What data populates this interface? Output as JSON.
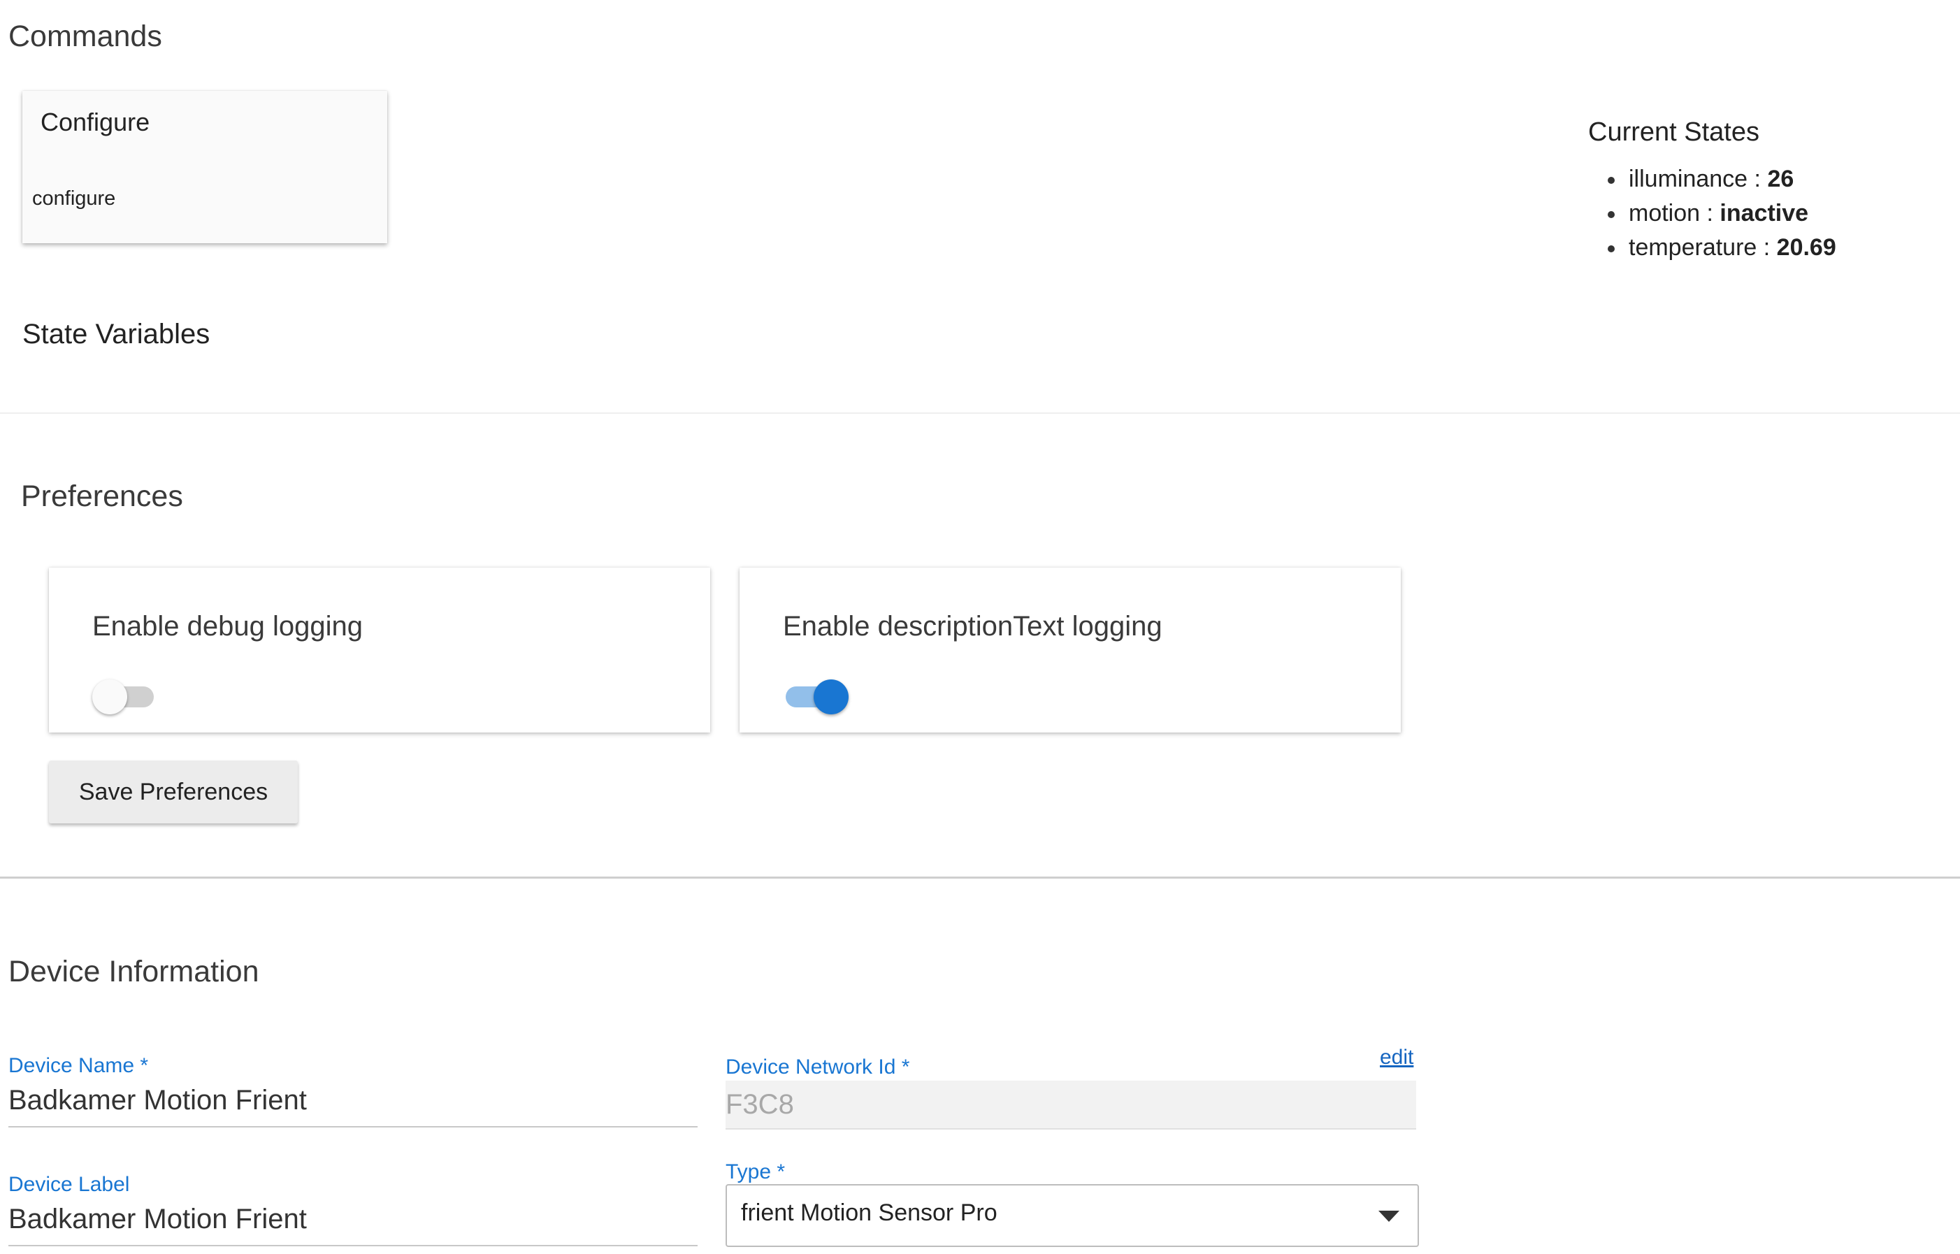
{
  "commands": {
    "title": "Commands",
    "card_title": "Configure",
    "card_button": "configure"
  },
  "current_states": {
    "title": "Current States",
    "items": [
      {
        "name": "illuminance",
        "sep": " : ",
        "value": "26"
      },
      {
        "name": "motion",
        "sep": " : ",
        "value": "inactive"
      },
      {
        "name": "temperature",
        "sep": " : ",
        "value": "20.69"
      }
    ]
  },
  "state_variables": {
    "title": "State Variables"
  },
  "preferences": {
    "title": "Preferences",
    "items": [
      {
        "label": "Enable debug logging",
        "enabled": false
      },
      {
        "label": "Enable descriptionText logging",
        "enabled": true
      }
    ],
    "save_label": "Save Preferences",
    "colors": {
      "toggle_on": "#1976d2",
      "toggle_on_track": "#92bfea",
      "toggle_off_track": "#d0d0d0"
    }
  },
  "device_info": {
    "title": "Device Information",
    "device_name": {
      "label": "Device Name *",
      "value": "Badkamer Motion Frient"
    },
    "device_label": {
      "label": "Device Label",
      "value": "Badkamer Motion Frient"
    },
    "network_id": {
      "label": "Device Network Id *",
      "value": "F3C8",
      "edit": "edit"
    },
    "type": {
      "label": "Type *",
      "value": "frient Motion Sensor Pro"
    },
    "colors": {
      "label": "#1976d2",
      "link": "#1565c0"
    }
  }
}
